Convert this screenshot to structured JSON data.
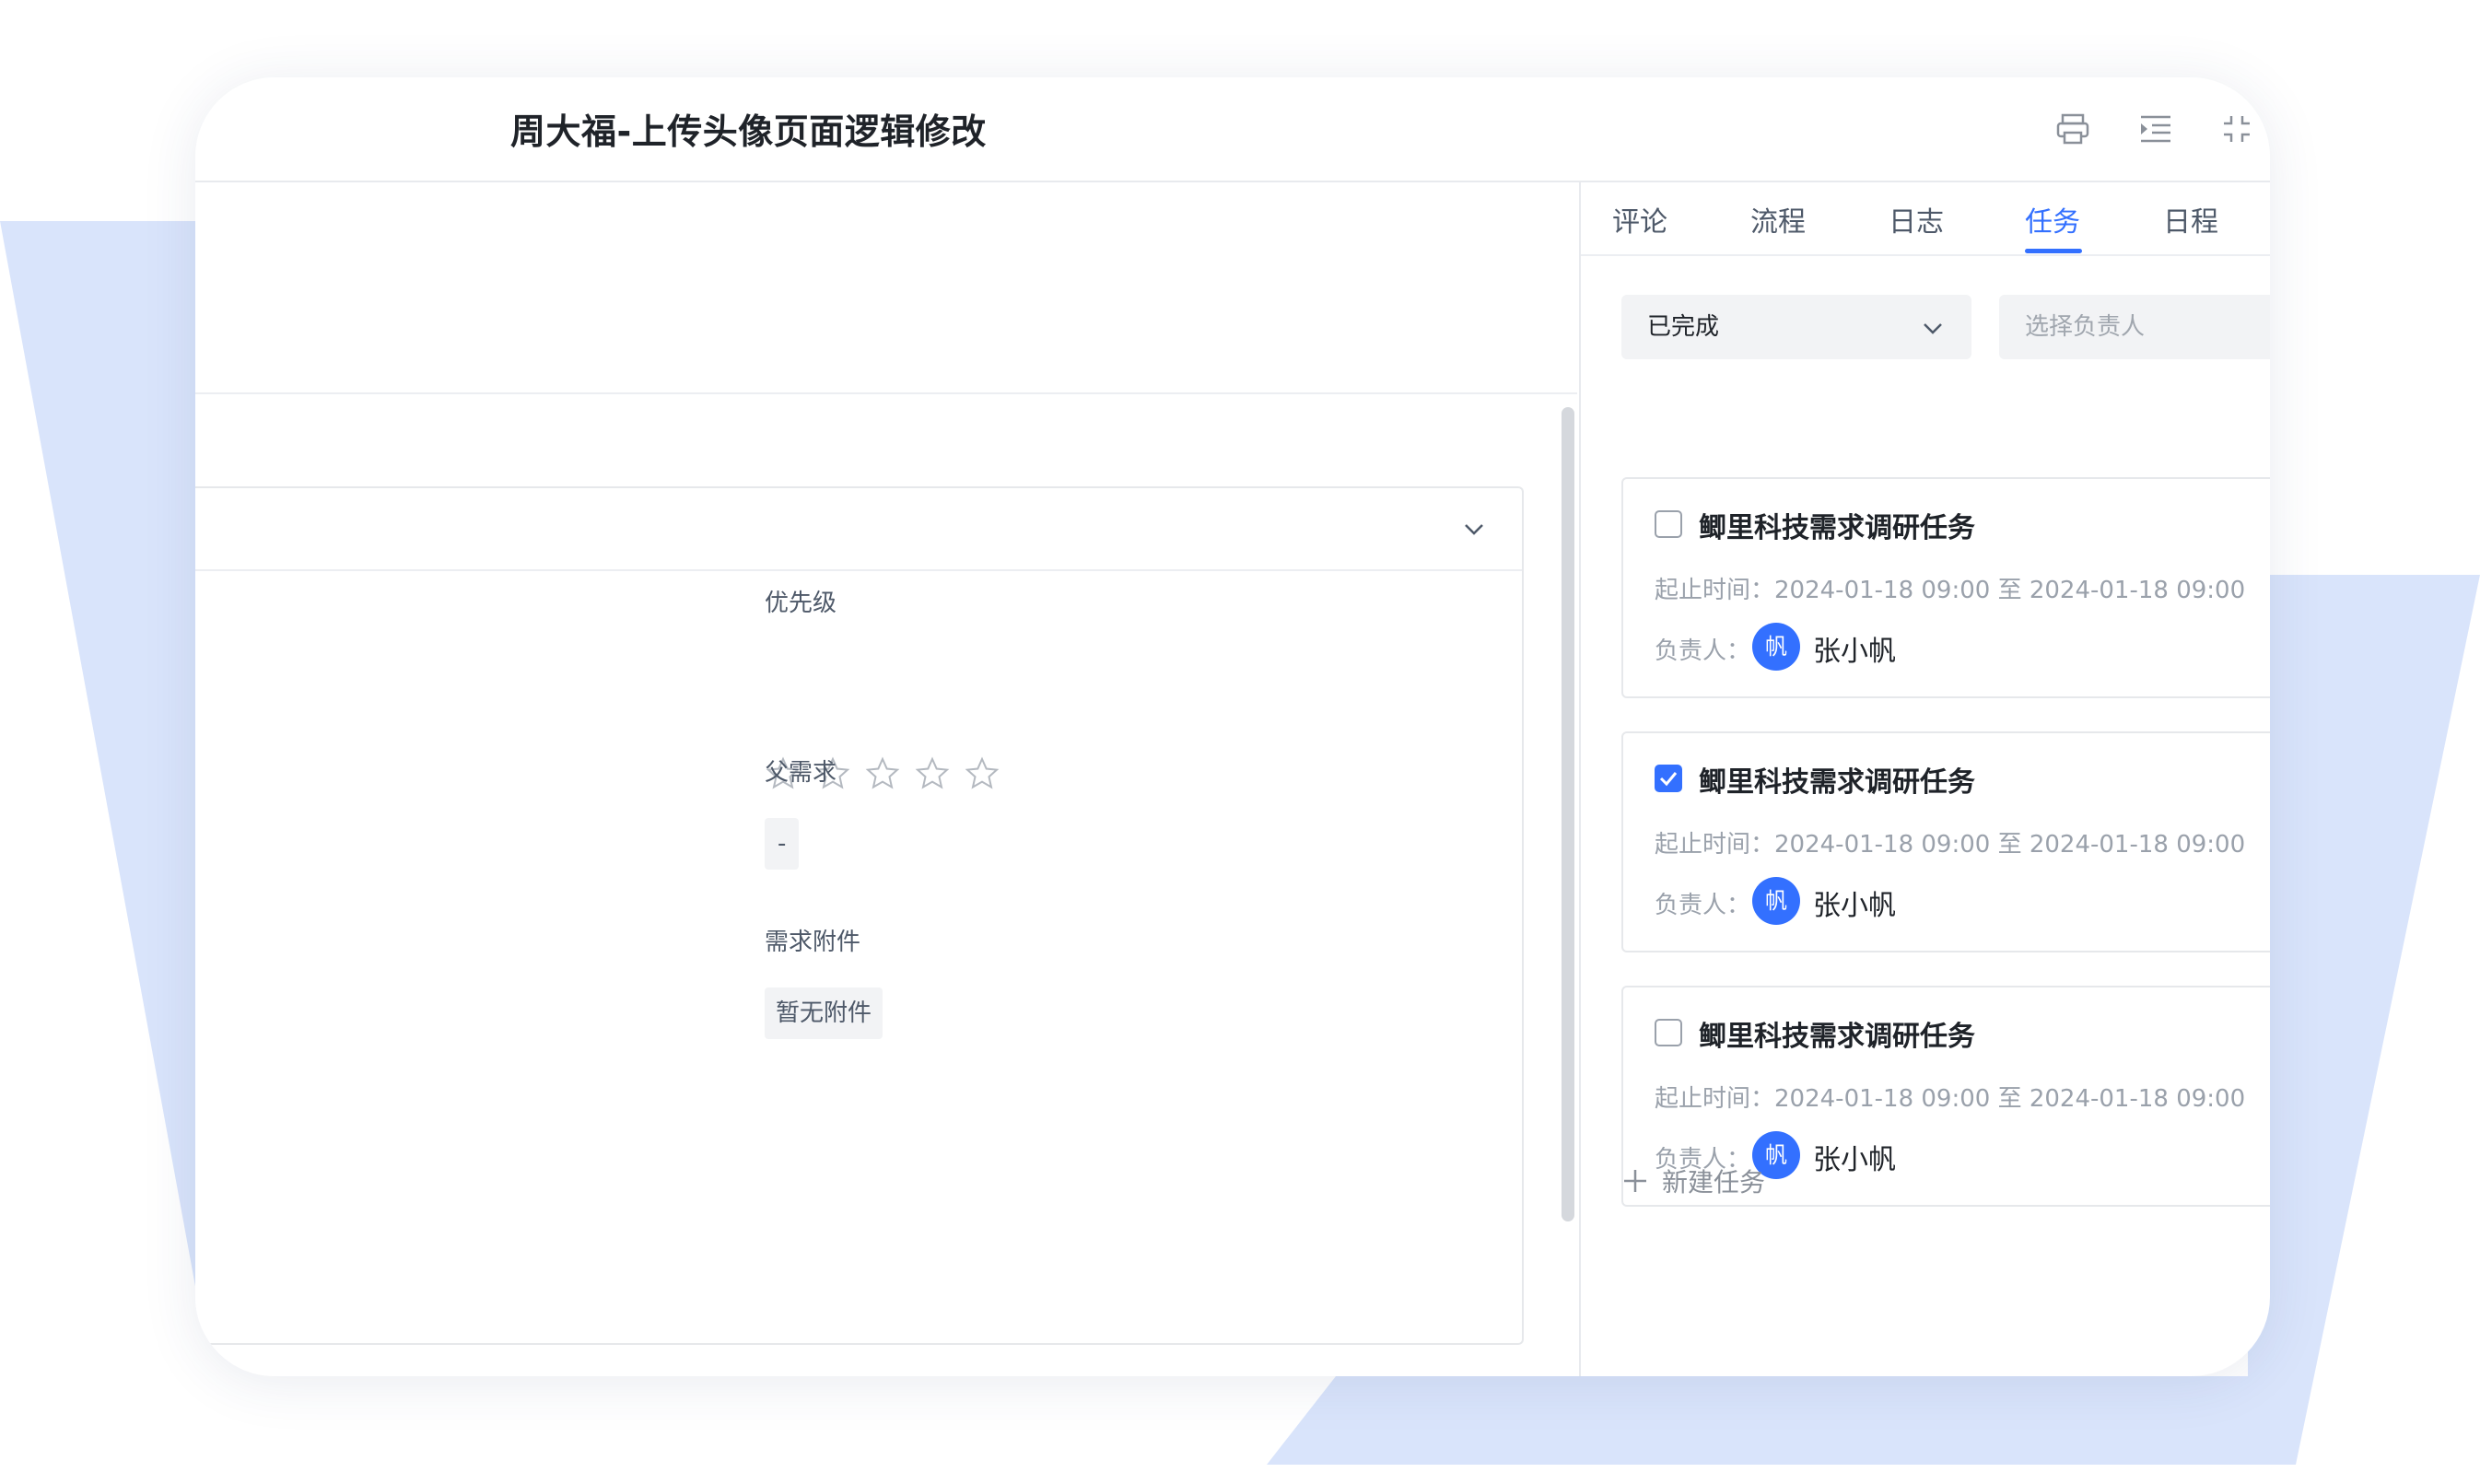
{
  "window": {
    "title": "周大福-上传头像页面逻辑修改"
  },
  "header_icons": [
    "print-icon",
    "indent-icon",
    "collapse-icon"
  ],
  "detail": {
    "priority_label": "优先级",
    "priority_rating": 0,
    "priority_max": 5,
    "parent_label": "父需求",
    "parent_value": "-",
    "attachment_label": "需求附件",
    "attachment_value": "暂无附件"
  },
  "tabs": [
    {
      "label": "评论"
    },
    {
      "label": "流程"
    },
    {
      "label": "日志"
    },
    {
      "label": "任务",
      "active": true
    },
    {
      "label": "日程"
    }
  ],
  "filters": {
    "status_value": "已完成",
    "assignee_placeholder": "选择负责人"
  },
  "tasks": [
    {
      "title": "鲫里科技需求调研任务",
      "checked": false,
      "time_label": "起止时间：",
      "time_range": "2024-01-18 09:00 至 2024-01-18 09:00",
      "owner_label": "负责人：",
      "owner_avatar": "帆",
      "owner_name": "张小帆"
    },
    {
      "title": "鲫里科技需求调研任务",
      "checked": true,
      "time_label": "起止时间：",
      "time_range": "2024-01-18 09:00 至 2024-01-18 09:00",
      "owner_label": "负责人：",
      "owner_avatar": "帆",
      "owner_name": "张小帆"
    },
    {
      "title": "鲫里科技需求调研任务",
      "checked": false,
      "time_label": "起止时间：",
      "time_range": "2024-01-18 09:00 至 2024-01-18 09:00",
      "owner_label": "负责人：",
      "owner_avatar": "帆",
      "owner_name": "张小帆"
    }
  ],
  "new_task_label": "新建任务",
  "colors": {
    "accent": "#3370ff",
    "decor": "#d9e4fb",
    "border": "#e6e8eb"
  }
}
